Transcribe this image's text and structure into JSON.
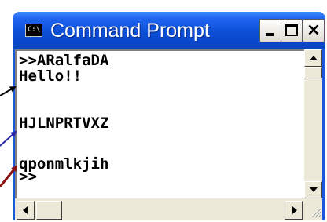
{
  "window": {
    "title": "Command Prompt",
    "app_icon_text": "C:\\",
    "close_glyph": "×"
  },
  "console": {
    "lines": [
      ">>ARalfaDA",
      "Hello!!",
      "",
      "HJLNPRTVXZ",
      "",
      "qponmlkjih",
      ">>"
    ]
  },
  "icons": {
    "app": "console-app-icon",
    "minimize": "minimize-icon",
    "maximize": "maximize-icon",
    "close": "close-icon",
    "scroll_up": "scroll-up-arrow-icon",
    "scroll_down": "scroll-down-arrow-icon",
    "scroll_left": "scroll-left-arrow-icon",
    "scroll_right": "scroll-right-arrow-icon",
    "resize_grip": "resize-grip-icon"
  },
  "colors": {
    "title_bar": "#0b4fd6",
    "arrow_to_hello": "#000000",
    "arrow_to_hjln": "#2d2aa8",
    "arrow_to_qpon": "#8b1010"
  }
}
